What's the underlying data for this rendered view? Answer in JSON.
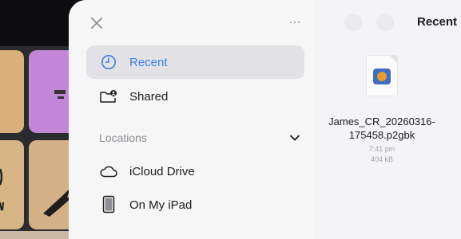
{
  "sidebar": {
    "close_icon": "close-icon",
    "more_icon": "ellipsis-icon",
    "items": [
      {
        "label": "Recent",
        "icon": "clock-icon",
        "selected": true
      },
      {
        "label": "Shared",
        "icon": "shared-folder-icon",
        "selected": false
      }
    ],
    "locations_header": "Locations",
    "locations": [
      {
        "label": "iCloud Drive",
        "icon": "cloud-icon"
      },
      {
        "label": "On My iPad",
        "icon": "ipad-icon"
      }
    ]
  },
  "content": {
    "title": "Recent",
    "file": {
      "name": "James_CR_20260316-175458.p2gbk",
      "time": "7:41 pm",
      "size": "404 kB"
    }
  },
  "colors": {
    "accent": "#3c7ee5",
    "selected_row": "#e2e2e6",
    "sheet_bg": "#f4f4f6"
  }
}
